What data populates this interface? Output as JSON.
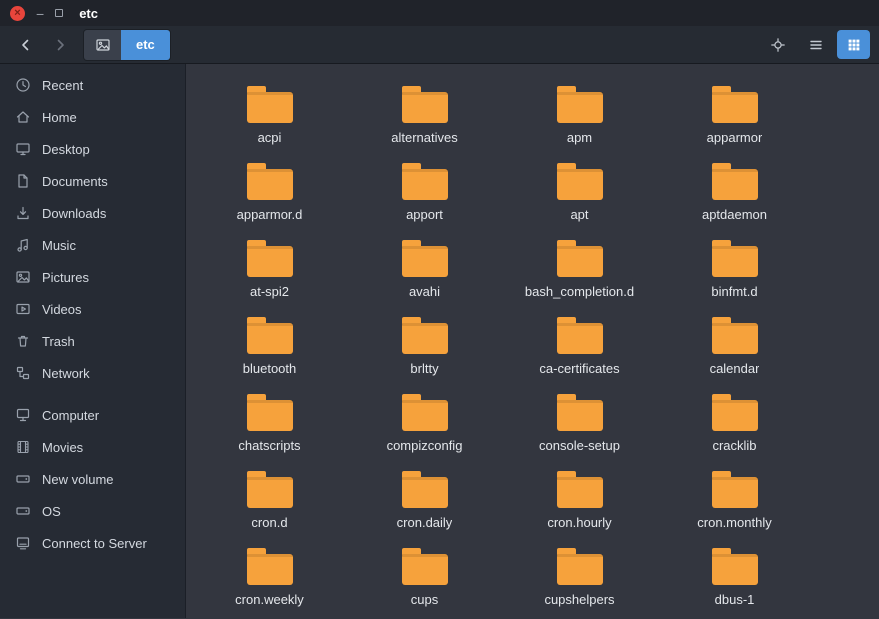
{
  "window": {
    "title": "etc",
    "controls": {
      "close_glyph": "×",
      "minimize_glyph": "−"
    }
  },
  "toolbar": {
    "back_icon": "chevron-left-icon",
    "forward_icon": "chevron-right-icon",
    "pathbar": {
      "root_icon": "picture-icon",
      "current": "etc"
    },
    "right_controls": [
      {
        "name": "location",
        "icon": "crosshair-icon",
        "active": false
      },
      {
        "name": "list-view",
        "icon": "list-icon",
        "active": false
      },
      {
        "name": "grid-view",
        "icon": "grid-icon",
        "active": true
      }
    ]
  },
  "sidebar": {
    "groups": [
      {
        "items": [
          {
            "label": "Recent",
            "icon": "clock"
          },
          {
            "label": "Home",
            "icon": "home"
          },
          {
            "label": "Desktop",
            "icon": "monitor"
          },
          {
            "label": "Documents",
            "icon": "document"
          },
          {
            "label": "Downloads",
            "icon": "download"
          },
          {
            "label": "Music",
            "icon": "music"
          },
          {
            "label": "Pictures",
            "icon": "picture"
          },
          {
            "label": "Videos",
            "icon": "video"
          },
          {
            "label": "Trash",
            "icon": "trash"
          },
          {
            "label": "Network",
            "icon": "network"
          }
        ]
      },
      {
        "items": [
          {
            "label": "Computer",
            "icon": "computer"
          },
          {
            "label": "Movies",
            "icon": "film"
          },
          {
            "label": "New volume",
            "icon": "drive"
          },
          {
            "label": "OS",
            "icon": "drive"
          },
          {
            "label": "Connect to Server",
            "icon": "server"
          }
        ]
      }
    ]
  },
  "main": {
    "folders": [
      "acpi",
      "alternatives",
      "apm",
      "apparmor",
      "apparmor.d",
      "apport",
      "apt",
      "aptdaemon",
      "at-spi2",
      "avahi",
      "bash_completion.d",
      "binfmt.d",
      "bluetooth",
      "brltty",
      "ca-certificates",
      "calendar",
      "chatscripts",
      "compizconfig",
      "console-setup",
      "cracklib",
      "cron.d",
      "cron.daily",
      "cron.hourly",
      "cron.monthly",
      "cron.weekly",
      "cups",
      "cupshelpers",
      "dbus-1"
    ]
  },
  "colors": {
    "accent": "#4a90d9",
    "folder": "#f6a23c",
    "close_button": "#e8453c"
  }
}
